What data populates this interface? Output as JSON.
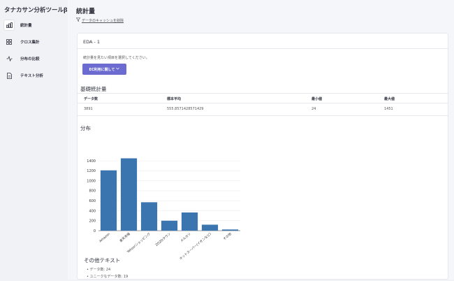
{
  "sidebar": {
    "app_title": "タナカサン分析ツールβ",
    "items": [
      {
        "label": "統計量",
        "icon": "bar-chart-icon",
        "active": true
      },
      {
        "label": "クロス集計",
        "icon": "grid-icon",
        "active": false
      },
      {
        "label": "分布の比較",
        "icon": "line-wave-icon",
        "active": false
      },
      {
        "label": "テキスト分析",
        "icon": "document-icon",
        "active": false
      }
    ]
  },
  "main": {
    "page_title": "統計量",
    "clear_cache": "データのキャッシュを削除",
    "card": {
      "title": "EDA - 1",
      "instruction": "統計量を見たい項目を選択してください。",
      "select_button": "EC利用に関して",
      "basic_stats_title": "基礎統計量",
      "stats_headers": [
        "データ数",
        "標本平均",
        "最小値",
        "最大値"
      ],
      "stats_values": [
        "3891",
        "555.8571428571429",
        "24",
        "1451"
      ],
      "distribution_title": "分布",
      "other_text_title": "その他テキスト",
      "other_text_items": [
        "データ数: 24",
        "ユニークなデータ数: 19"
      ]
    }
  },
  "colors": {
    "bar": "#3b75af",
    "button": "#6b6bd0"
  },
  "chart_data": {
    "type": "bar",
    "categories": [
      "Amazon",
      "楽天市場",
      "Yahoo!ショッピング",
      "ZOZOタウン",
      "メルカリ",
      "ネットスーパー(イオンなど)",
      "その他"
    ],
    "values": [
      1210,
      1451,
      570,
      200,
      365,
      120,
      24
    ],
    "ylim": [
      0,
      1500
    ],
    "yticks": [
      0,
      200,
      400,
      600,
      800,
      1000,
      1200,
      1400
    ],
    "title": "",
    "xlabel": "",
    "ylabel": "",
    "grid": true
  }
}
